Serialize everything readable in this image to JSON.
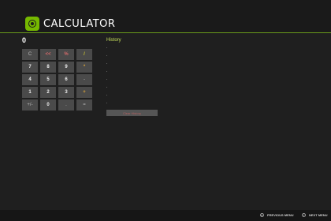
{
  "header": {
    "title": "CALCULATOR",
    "icon": "calculator-app-icon"
  },
  "display": {
    "value": "0"
  },
  "keypad": {
    "keys": [
      {
        "label": "C",
        "kind": "muted"
      },
      {
        "label": "<<",
        "kind": "red"
      },
      {
        "label": "%",
        "kind": "red"
      },
      {
        "label": "/",
        "kind": "slash"
      },
      {
        "label": "7",
        "kind": "digit"
      },
      {
        "label": "8",
        "kind": "digit"
      },
      {
        "label": "9",
        "kind": "digit"
      },
      {
        "label": "*",
        "kind": "op"
      },
      {
        "label": "4",
        "kind": "digit"
      },
      {
        "label": "5",
        "kind": "digit"
      },
      {
        "label": "6",
        "kind": "digit"
      },
      {
        "label": "-",
        "kind": "muted"
      },
      {
        "label": "1",
        "kind": "digit"
      },
      {
        "label": "2",
        "kind": "digit"
      },
      {
        "label": "3",
        "kind": "digit"
      },
      {
        "label": "+",
        "kind": "op"
      },
      {
        "label": "+/-",
        "kind": "muted"
      },
      {
        "label": "0",
        "kind": "digit"
      },
      {
        "label": ".",
        "kind": "muted"
      },
      {
        "label": "=",
        "kind": "muted"
      }
    ]
  },
  "history": {
    "title": "History",
    "clear_label": "Clear History"
  },
  "footer": {
    "previous_menu": "PREVIOUS MENU",
    "next_menu": "NEXT MENU",
    "previous_glyph": "B",
    "next_glyph": "Y"
  },
  "colors": {
    "accent": "#76b900",
    "background": "#1f1f1f",
    "key": "#4a4a4a"
  }
}
